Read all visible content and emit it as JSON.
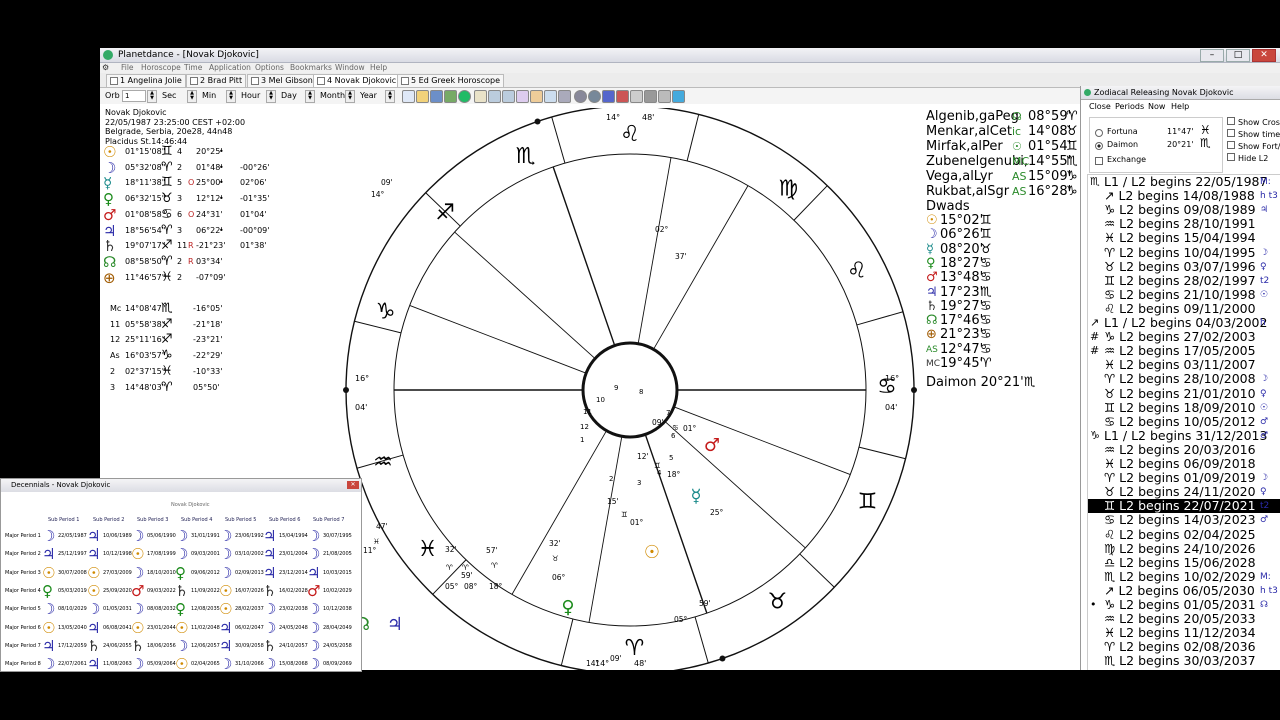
{
  "app": {
    "title": "Planetdance - [Novak Djokovic]",
    "menu": [
      "File",
      "Horoscope",
      "Time",
      "Application",
      "Options",
      "Bookmarks",
      "Window",
      "Help"
    ],
    "tabs": [
      "1 Angelina Jolie",
      "2 Brad Pitt",
      "3 Mel Gibson",
      "4 Novak Djokovic",
      "5 Ed Greek Horoscope"
    ],
    "toolbar": {
      "orb_label": "Orb",
      "orb_value": "1",
      "sec_label": "Sec",
      "min_label": "Min",
      "hour_label": "Hour",
      "day_label": "Day",
      "month_label": "Month",
      "year_label": "Year"
    }
  },
  "chart_info": {
    "name": "Novak Djokovic",
    "datetime": "22/05/1987 23:25:00 CEST +02:00",
    "place": "Belgrade, Serbia, 20e28, 44n48",
    "system": "Placidus St.14:46:44"
  },
  "planets": [
    {
      "glyph": "☉",
      "color": "#d08a00",
      "pos": "01°15'08\"",
      "sign": "♊",
      "house": "4",
      "decl": "20°25'",
      "dot": "•",
      "extra": "",
      "aspect": ""
    },
    {
      "glyph": "☽",
      "color": "#2a2aa8",
      "pos": "05°32'08\"",
      "sign": "♈",
      "house": "2",
      "decl": "01°48'",
      "dot": "•",
      "extra": "",
      "aspect": "-00°26'"
    },
    {
      "glyph": "☿",
      "color": "#1a8a8a",
      "pos": "18°11'38\"",
      "sign": "♊",
      "house": "5",
      "decl": "25°00'",
      "dot": "•",
      "extra": "O",
      "aspect": "02°06'"
    },
    {
      "glyph": "♀",
      "color": "#1a8a1a",
      "pos": "06°32'15\"",
      "sign": "♉",
      "house": "3",
      "decl": "12°12'",
      "dot": "•",
      "extra": "",
      "aspect": "-01°35'"
    },
    {
      "glyph": "♂",
      "color": "#c41a1a",
      "pos": "01°08'58\"",
      "sign": "♋",
      "house": "6",
      "decl": "24°31'",
      "dot": "",
      "extra": "O",
      "aspect": "01°04'"
    },
    {
      "glyph": "♃",
      "color": "#2a2aa8",
      "pos": "18°56'54\"",
      "sign": "♈",
      "house": "3",
      "decl": "06°22'",
      "dot": "•",
      "extra": "",
      "aspect": "-00°09'"
    },
    {
      "glyph": "♄",
      "color": "#333",
      "pos": "19°07'17\"",
      "sign": "♐",
      "house": "11",
      "decl": "-21°23'",
      "dot": "",
      "extra": "R",
      "aspect": "01°38'"
    },
    {
      "glyph": "☊",
      "color": "#2a8a2a",
      "pos": "08°58'50\"",
      "sign": "♈",
      "house": "2",
      "decl": "03°34'",
      "dot": "",
      "extra": "R",
      "aspect": ""
    },
    {
      "glyph": "⊕",
      "color": "#a05a00",
      "pos": "11°46'57\"",
      "sign": "♓",
      "house": "2",
      "decl": "-07°09'",
      "dot": "",
      "extra": "",
      "aspect": ""
    }
  ],
  "angles": [
    {
      "name": "Mc",
      "pos": "14°08'47\"",
      "sign": "♏",
      "decl": "-16°05'"
    },
    {
      "name": "11",
      "pos": "05°58'38\"",
      "sign": "♐",
      "decl": "-21°18'"
    },
    {
      "name": "12",
      "pos": "25°11'16\"",
      "sign": "♐",
      "decl": "-23°21'"
    },
    {
      "name": "As",
      "pos": "16°03'57\"",
      "sign": "♑",
      "decl": "-22°29'"
    },
    {
      "name": "2",
      "pos": "02°37'15\"",
      "sign": "♓",
      "decl": "-10°33'"
    },
    {
      "name": "3",
      "pos": "14°48'03\"",
      "sign": "♈",
      "decl": "05°50'"
    }
  ],
  "fixed_stars": [
    {
      "name": "Algenib,gaPeg",
      "glyph": "☊",
      "pos": "08°59'",
      "sign": "♈"
    },
    {
      "name": "Menkar,alCet",
      "glyph": "ic",
      "pos": "14°08'",
      "sign": "♉"
    },
    {
      "name": "Mirfak,alPer",
      "glyph": "☉",
      "pos": "01°54'",
      "sign": "♊"
    },
    {
      "name": "Zubenelgenubi,",
      "glyph": "MC",
      "pos": "14°55'",
      "sign": "♏"
    },
    {
      "name": "Vega,alLyr",
      "glyph": "AS",
      "pos": "15°09'",
      "sign": "♑"
    },
    {
      "name": "Rukbat,alSgr",
      "glyph": "AS",
      "pos": "16°28'",
      "sign": "♑"
    }
  ],
  "dwads": {
    "title": "Dwads",
    "items": [
      {
        "glyph": "☉",
        "color": "#d08a00",
        "pos": "15°02'",
        "sign": "♊"
      },
      {
        "glyph": "☽",
        "color": "#2a2aa8",
        "pos": "06°26'",
        "sign": "♊"
      },
      {
        "glyph": "☿",
        "color": "#1a8a8a",
        "pos": "08°20'",
        "sign": "♉"
      },
      {
        "glyph": "♀",
        "color": "#1a8a1a",
        "pos": "18°27'",
        "sign": "♋"
      },
      {
        "glyph": "♂",
        "color": "#c41a1a",
        "pos": "13°48'",
        "sign": "♋"
      },
      {
        "glyph": "♃",
        "color": "#2a2aa8",
        "pos": "17°23'",
        "sign": "♏"
      },
      {
        "glyph": "♄",
        "color": "#333",
        "pos": "19°27'",
        "sign": "♋"
      },
      {
        "glyph": "☊",
        "color": "#2a8a2a",
        "pos": "17°46'",
        "sign": "♋"
      },
      {
        "glyph": "⊕",
        "color": "#a05a00",
        "pos": "21°23'",
        "sign": "♋"
      },
      {
        "glyph": "AS",
        "color": "#2a8a2a",
        "pos": "12°47'",
        "sign": "♋"
      },
      {
        "glyph": "MC",
        "color": "#333",
        "pos": "19°45'",
        "sign": "♈"
      }
    ],
    "daimon": "Daimon 20°21'♏"
  },
  "wheel": {
    "top_cusp": {
      "deg": "14°",
      "sign": "♌",
      "min": "48'"
    },
    "bottom_cusp": {
      "deg": "14°",
      "sign": "♈",
      "min": "48'"
    },
    "left_cusp": {
      "deg": "16°",
      "min": "04'"
    },
    "right_cusp": {
      "deg": "16°",
      "min": "04'"
    },
    "inner_numbers": [
      "9",
      "8",
      "10",
      "7",
      "11",
      "6",
      "12",
      "5",
      "1",
      "4",
      "2",
      "3"
    ]
  },
  "decennials": {
    "title": "Decennials - Novak Djokovic",
    "subtitle": "Novak Djokovic",
    "headers": [
      "Sub Period 1",
      "Sub Period 2",
      "Sub Period 3",
      "Sub Period 4",
      "Sub Period 5",
      "Sub Period 6",
      "Sub Period 7"
    ],
    "rows": [
      {
        "label": "Major Period 1",
        "cells": [
          [
            "☽",
            "22/05/1987"
          ],
          [
            "♃",
            "10/06/1989"
          ],
          [
            "☽",
            "05/06/1990"
          ],
          [
            "☽",
            "31/01/1991"
          ],
          [
            "☽",
            "23/06/1992"
          ],
          [
            "♃",
            "15/04/1994"
          ],
          [
            "☽",
            "30/07/1995"
          ]
        ]
      },
      {
        "label": "Major Period 2",
        "cells": [
          [
            "♃",
            "25/12/1997"
          ],
          [
            "♃",
            "10/12/1998"
          ],
          [
            "☉",
            "17/08/1999"
          ],
          [
            "☽",
            "09/03/2001"
          ],
          [
            "☽",
            "03/10/2002"
          ],
          [
            "♃",
            "23/01/2004"
          ],
          [
            "☽",
            "21/08/2005"
          ]
        ]
      },
      {
        "label": "Major Period 3",
        "cells": [
          [
            "☉",
            "30/07/2008"
          ],
          [
            "☉",
            "27/03/2009"
          ],
          [
            "☽",
            "18/10/2010"
          ],
          [
            "♀",
            "09/06/2012"
          ],
          [
            "☽",
            "02/09/2013"
          ],
          [
            "♃",
            "23/12/2014"
          ],
          [
            "♃",
            "10/03/2015"
          ]
        ]
      },
      {
        "label": "Major Period 4",
        "cells": [
          [
            "♀",
            "05/03/2019"
          ],
          [
            "☉",
            "25/09/2020"
          ],
          [
            "♂",
            "09/03/2022"
          ],
          [
            "♄",
            "11/09/2022"
          ],
          [
            "☉",
            "16/07/2026"
          ],
          [
            "♄",
            "16/02/2028"
          ],
          [
            "♂",
            "10/02/2029"
          ]
        ]
      },
      {
        "label": "Major Period 5",
        "cells": [
          [
            "☽",
            "08/10/2029"
          ],
          [
            "☽",
            "01/05/2031"
          ],
          [
            "☽",
            "08/08/2032"
          ],
          [
            "♀",
            "12/08/2035"
          ],
          [
            "☉",
            "28/02/2037"
          ],
          [
            "☽",
            "23/02/2038"
          ],
          [
            "☽",
            "10/12/2038"
          ]
        ]
      },
      {
        "label": "Major Period 6",
        "cells": [
          [
            "☉",
            "13/05/2040"
          ],
          [
            "♃",
            "06/08/2041"
          ],
          [
            "☉",
            "23/01/2044"
          ],
          [
            "☉",
            "11/02/2048"
          ],
          [
            "♃",
            "06/02/2047"
          ],
          [
            "☽",
            "24/05/2048"
          ],
          [
            "☽",
            "28/04/2049"
          ]
        ]
      },
      {
        "label": "Major Period 7",
        "cells": [
          [
            "♃",
            "17/12/2059"
          ],
          [
            "♄",
            "24/06/2055"
          ],
          [
            "♄",
            "18/06/2056"
          ],
          [
            "☽",
            "12/06/2057"
          ],
          [
            "♃",
            "30/09/2058"
          ],
          [
            "♄",
            "24/10/2057"
          ],
          [
            "☽",
            "24/05/2058"
          ]
        ]
      },
      {
        "label": "Major Period 8",
        "cells": [
          [
            "☽",
            "22/07/2061"
          ],
          [
            "♃",
            "11/08/2063"
          ],
          [
            "☽",
            "05/09/2064"
          ],
          [
            "☉",
            "02/04/2065"
          ],
          [
            "☽",
            "31/10/2066"
          ],
          [
            "☽",
            "15/08/2068"
          ],
          [
            "☽",
            "08/09/2069"
          ]
        ]
      }
    ]
  },
  "zr": {
    "title": "Zodiacal Releasing Novak Djokovic",
    "menu": [
      "Close",
      "Periods",
      "Now",
      "Help"
    ],
    "fortuna_label": "Fortuna",
    "fortuna_pos": "11°47'",
    "fortuna_sign": "♓",
    "daimon_label": "Daimon",
    "daimon_pos": "20°21'",
    "daimon_sign": "♏",
    "exchange_label": "Exchange",
    "checkbox_labels": [
      "Show Cross",
      "Show time",
      "Show Fort/D",
      "Hide L2"
    ],
    "rows": [
      {
        "marker": "♏",
        "text": "L1 / L2 begins 22/05/1987",
        "tail": "M:"
      },
      {
        "marker": "",
        "text": "↗ L2 begins 14/08/1988",
        "tail": "h t3"
      },
      {
        "marker": "",
        "text": "♑ L2 begins 09/08/1989",
        "tail": "♃"
      },
      {
        "marker": "",
        "text": "♒ L2 begins 28/10/1991",
        "tail": ""
      },
      {
        "marker": "",
        "text": "♓ L2 begins 15/04/1994",
        "tail": ""
      },
      {
        "marker": "",
        "text": "♈ L2 begins 10/04/1995",
        "tail": "☽"
      },
      {
        "marker": "",
        "text": "♉ L2 begins 03/07/1996",
        "tail": "♀"
      },
      {
        "marker": "",
        "text": "♊ L2 begins 28/02/1997",
        "tail": "t2"
      },
      {
        "marker": "",
        "text": "♋ L2 begins 21/10/1998",
        "tail": "☉"
      },
      {
        "marker": "",
        "text": "♌ L2 begins 09/11/2000",
        "tail": ""
      },
      {
        "marker": "↗",
        "text": "L1 / L2 begins 04/03/2002",
        "tail": "h"
      },
      {
        "marker": "#",
        "text": "♑ L2 begins 27/02/2003",
        "tail": ""
      },
      {
        "marker": "#",
        "text": "♒ L2 begins 17/05/2005",
        "tail": ""
      },
      {
        "marker": "",
        "text": "♓ L2 begins 03/11/2007",
        "tail": ""
      },
      {
        "marker": "",
        "text": "♈ L2 begins 28/10/2008",
        "tail": "☽"
      },
      {
        "marker": "",
        "text": "♉ L2 begins 21/01/2010",
        "tail": "♀"
      },
      {
        "marker": "",
        "text": "♊ L2 begins 18/09/2010",
        "tail": "☉"
      },
      {
        "marker": "",
        "text": "♋ L2 begins 10/05/2012",
        "tail": "♂"
      },
      {
        "marker": "♑",
        "text": "L1 / L2 begins 31/12/2013",
        "tail": "♂"
      },
      {
        "marker": "",
        "text": "♒ L2 begins 20/03/2016",
        "tail": ""
      },
      {
        "marker": "",
        "text": "♓ L2 begins 06/09/2018",
        "tail": ""
      },
      {
        "marker": "",
        "text": "♈ L2 begins 01/09/2019",
        "tail": "☽"
      },
      {
        "marker": "",
        "text": "♉ L2 begins 24/11/2020",
        "tail": "♀"
      },
      {
        "marker": "",
        "text": "♊ L2 begins 22/07/2021",
        "tail": "t2",
        "selected": true
      },
      {
        "marker": "",
        "text": "♋ L2 begins 14/03/2023",
        "tail": "♂"
      },
      {
        "marker": "",
        "text": "♌ L2 begins 02/04/2025",
        "tail": ""
      },
      {
        "marker": "",
        "text": "♍ L2 begins 24/10/2026",
        "tail": ""
      },
      {
        "marker": "",
        "text": "♎ L2 begins 15/06/2028",
        "tail": ""
      },
      {
        "marker": "",
        "text": "♏ L2 begins 10/02/2029",
        "tail": "M:"
      },
      {
        "marker": "",
        "text": "↗ L2 begins 06/05/2030",
        "tail": "h t3"
      },
      {
        "marker": "•",
        "text": "♑ L2 begins 01/05/2031",
        "tail": "☊"
      },
      {
        "marker": "",
        "text": "♒ L2 begins 20/05/2033",
        "tail": ""
      },
      {
        "marker": "",
        "text": "♓ L2 begins 11/12/2034",
        "tail": ""
      },
      {
        "marker": "",
        "text": "♈ L2 begins 02/08/2036",
        "tail": ""
      },
      {
        "marker": "",
        "text": "♏ L2 begins 30/03/2037",
        "tail": ""
      }
    ]
  }
}
